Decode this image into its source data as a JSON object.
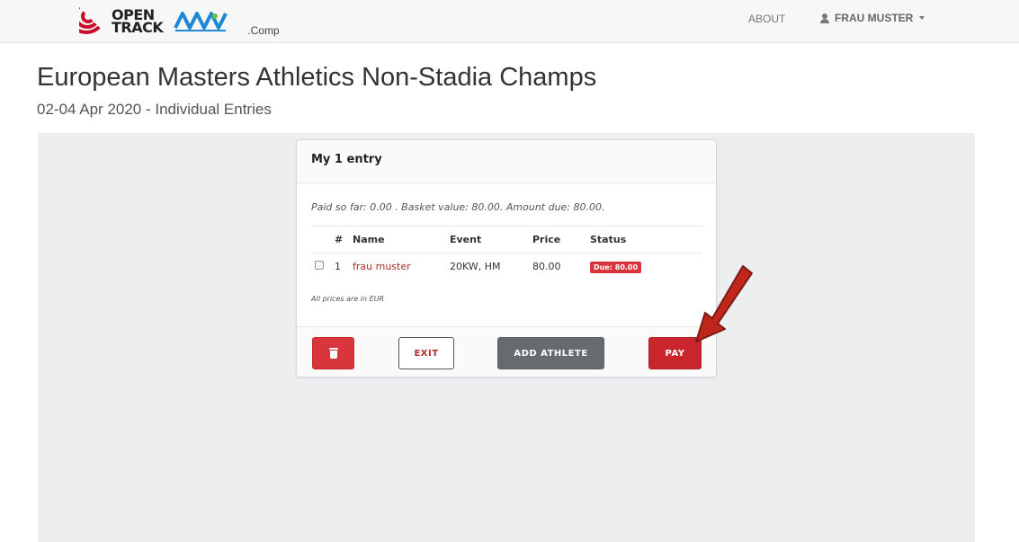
{
  "nav": {
    "logo_line1": "OPEN",
    "logo_line2": "TRACK",
    "logo_secondary": "AEAM",
    "logo_suffix": ".Comp",
    "about_label": "ABOUT",
    "user_label": "FRAU MUSTER"
  },
  "page": {
    "title": "European Masters Athletics Non-Stadia Champs",
    "subtitle": "02-04 Apr 2020 - Individual Entries"
  },
  "card": {
    "header": "My 1 entry",
    "paid_line": "Paid so far: 0.00 . Basket value: 80.00. Amount due: 80.00.",
    "columns": [
      "#",
      "Name",
      "Event",
      "Price",
      "Status"
    ],
    "rows": [
      {
        "num": "1",
        "name": "frau muster",
        "event": "20KW, HM",
        "price": "80.00",
        "status": "Due: 80.00"
      }
    ],
    "currency_note": "All prices are in EUR",
    "buttons": {
      "exit": "EXIT",
      "add_athlete": "ADD ATHLETE",
      "pay": "PAY"
    }
  },
  "colors": {
    "accent_red": "#c8262c",
    "badge_red": "#d9353d",
    "panel_grey": "#eceef0",
    "button_grey": "#666b70"
  }
}
